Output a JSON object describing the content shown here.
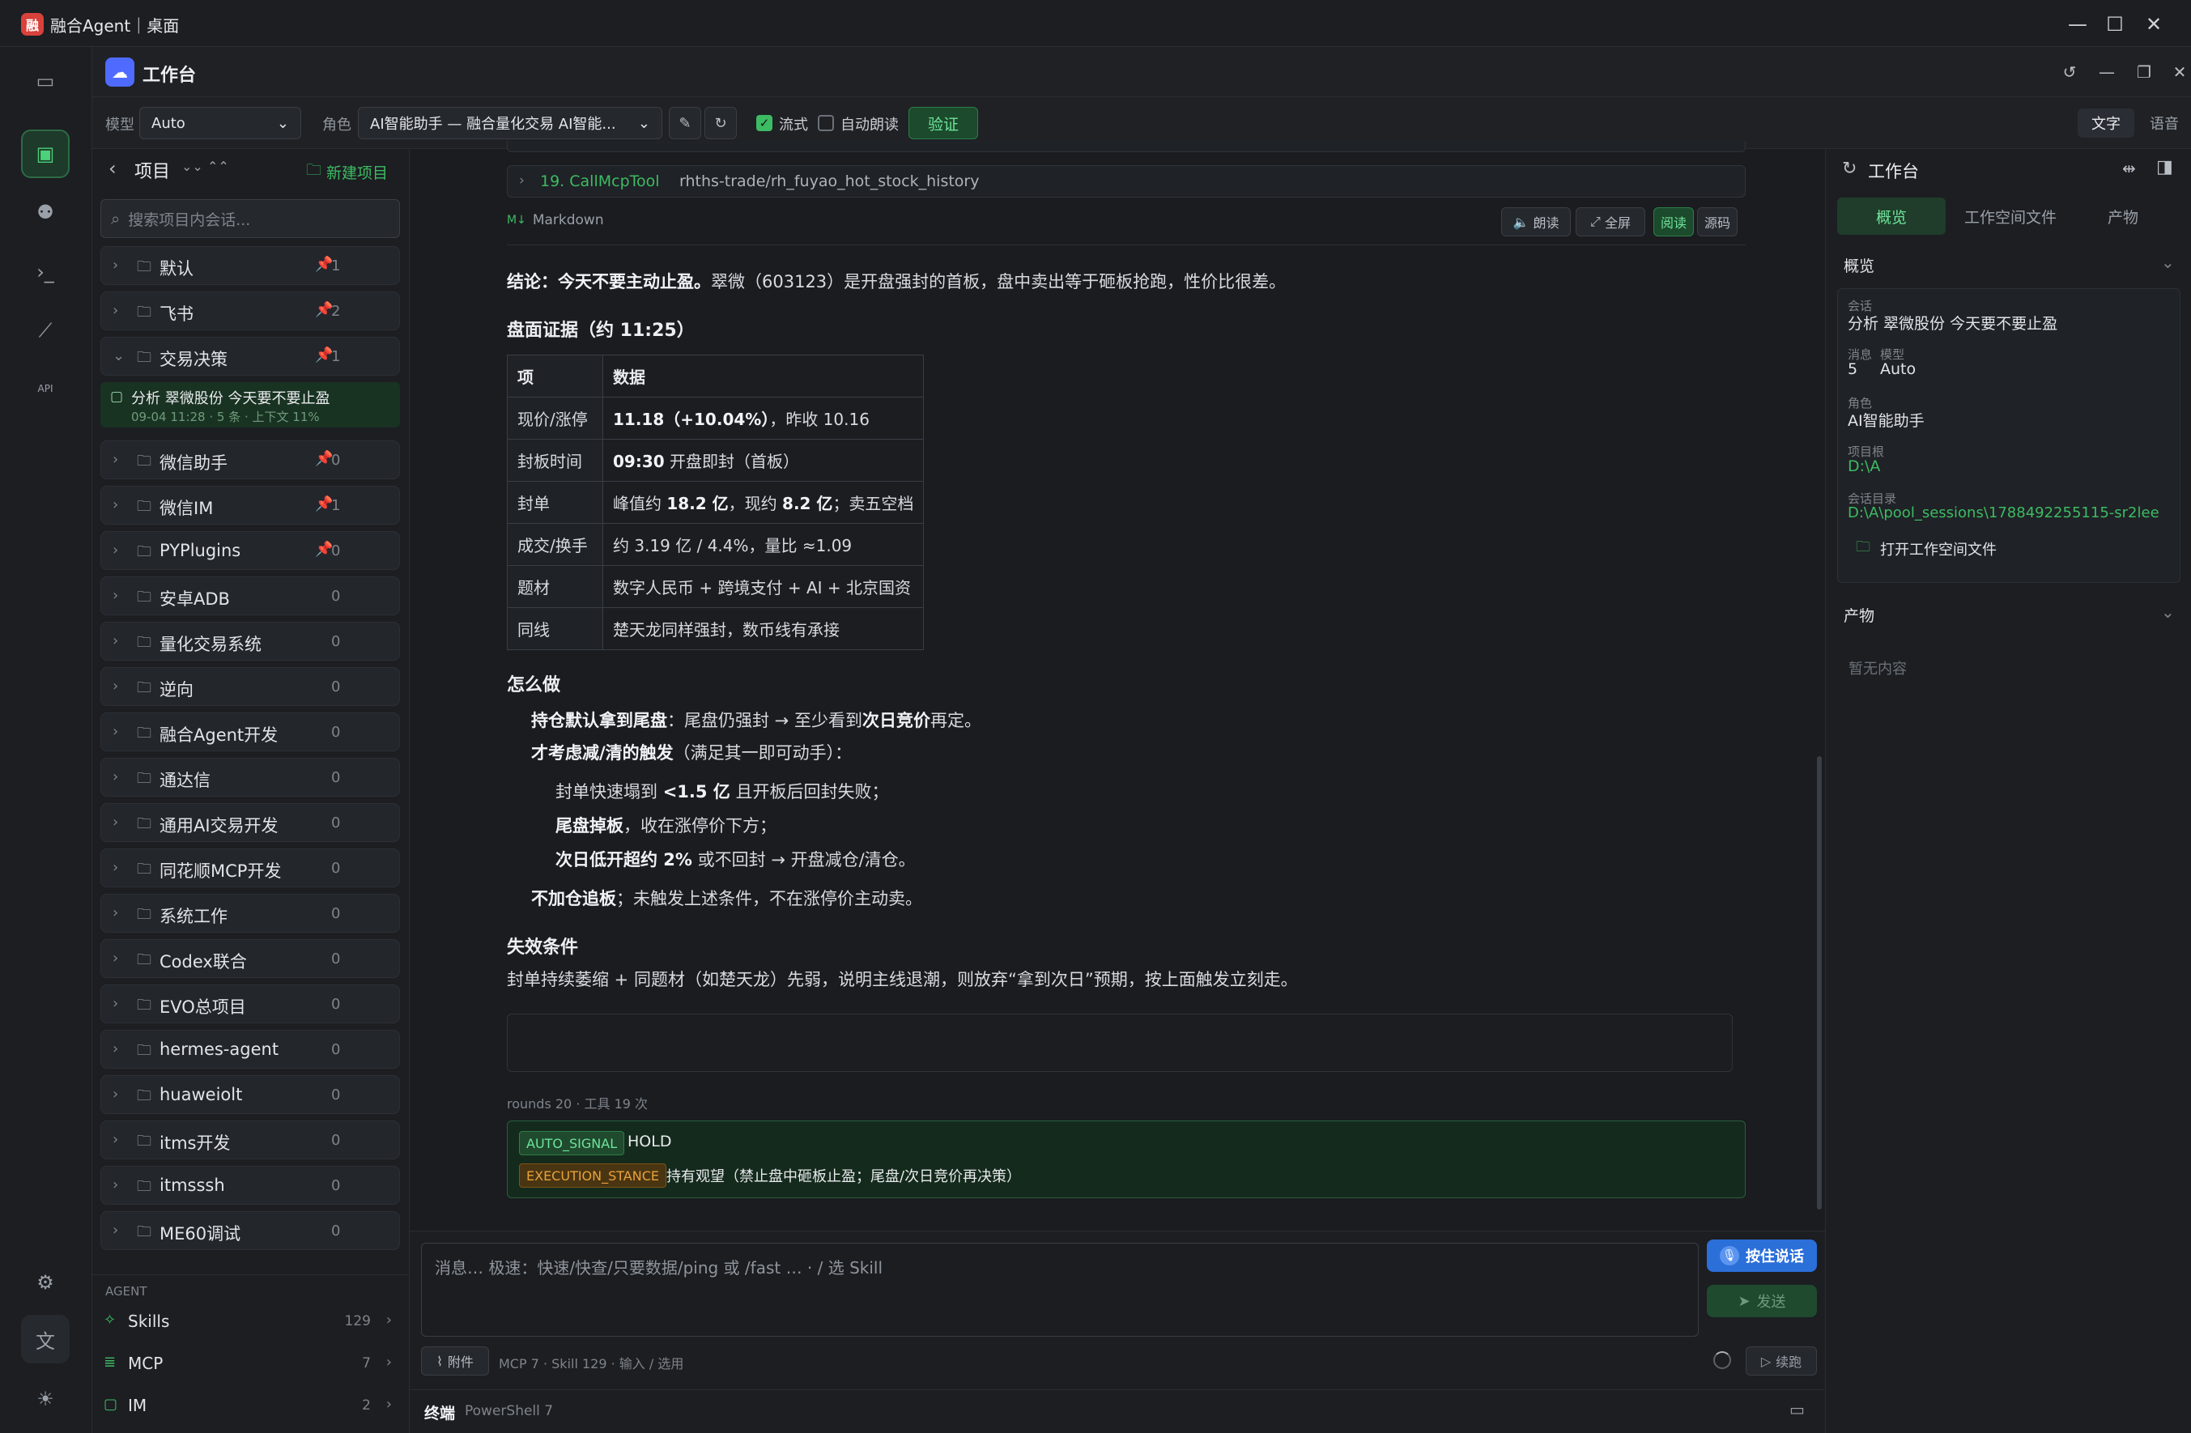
{
  "window": {
    "title": "融合Agent｜桌面",
    "logo": "融"
  },
  "app": {
    "title": "工作台",
    "icon": "☁"
  },
  "toolbar": {
    "model_label": "模型",
    "model_value": "Auto",
    "role_label": "角色",
    "role_value": "AI智能助手 — 融合量化交易 AI智能...",
    "stream_label": "流式",
    "stream_checked": true,
    "autoread_label": "自动朗读",
    "autoread_checked": false,
    "verify_label": "验证",
    "mode_text": "文字",
    "mode_voice": "语音"
  },
  "sidebar": {
    "back": "‹",
    "title": "项目",
    "new_project": "新建项目",
    "search_placeholder": "搜索项目内会话...",
    "projects": [
      {
        "name": "默认",
        "pin": true,
        "count": "1"
      },
      {
        "name": "飞书",
        "pin": true,
        "count": "2"
      },
      {
        "name": "交易决策",
        "pin": true,
        "count": "1",
        "expanded": true
      },
      {
        "name": "微信助手",
        "pin": true,
        "count": "0"
      },
      {
        "name": "微信IM",
        "pin": true,
        "count": "1"
      },
      {
        "name": "PYPlugins",
        "pin": true,
        "count": "0"
      },
      {
        "name": "安卓ADB",
        "pin": false,
        "count": "0"
      },
      {
        "name": "量化交易系统",
        "pin": false,
        "count": "0"
      },
      {
        "name": "逆向",
        "pin": false,
        "count": "0"
      },
      {
        "name": "融合Agent开发",
        "pin": false,
        "count": "0"
      },
      {
        "name": "通达信",
        "pin": false,
        "count": "0"
      },
      {
        "name": "通用AI交易开发",
        "pin": false,
        "count": "0"
      },
      {
        "name": "同花顺MCP开发",
        "pin": false,
        "count": "0"
      },
      {
        "name": "系统工作",
        "pin": false,
        "count": "0"
      },
      {
        "name": "Codex联合",
        "pin": false,
        "count": "0"
      },
      {
        "name": "EVO总项目",
        "pin": false,
        "count": "0"
      },
      {
        "name": "hermes-agent",
        "pin": false,
        "count": "0"
      },
      {
        "name": "huaweiolt",
        "pin": false,
        "count": "0"
      },
      {
        "name": "itms开发",
        "pin": false,
        "count": "0"
      },
      {
        "name": "itmsssh",
        "pin": false,
        "count": "0"
      },
      {
        "name": "ME60调试",
        "pin": false,
        "count": "0"
      }
    ],
    "session": {
      "title": "分析 翠微股份 今天要不要止盈",
      "meta": "09-04 11:28 · 5 条 · 上下文 11%"
    },
    "agent_header": "AGENT",
    "agent_items": [
      {
        "name": "Skills",
        "count": "129"
      },
      {
        "name": "MCP",
        "count": "7"
      },
      {
        "name": "IM",
        "count": "2"
      }
    ]
  },
  "chat": {
    "tool_call": {
      "title": "19. CallMcpTool",
      "args": "rhths-trade/rh_fuyao_hot_stock_history"
    },
    "format_label": "Markdown",
    "md_buttons": {
      "read_aloud": "朗读",
      "fullscreen": "全屏",
      "read": "阅读",
      "source": "源码"
    },
    "conclusion_bold": "结论：今天不要主动止盈。",
    "conclusion_rest": "翠微（603123）是开盘强封的首板，盘中卖出等于砸板抢跑，性价比很差。",
    "evidence_title": "盘面证据（约 11:25）",
    "table_headers": [
      "项",
      "数据"
    ],
    "table_rows": [
      {
        "k": "现价/涨停",
        "v1": "11.18（+10.04%）",
        "v2": "，昨收 10.16"
      },
      {
        "k": "封板时间",
        "v1": "09:30",
        "v2": " 开盘即封（首板）"
      },
      {
        "k": "封单",
        "v0": "峰值约 ",
        "v1": "18.2 亿",
        "v2": "，现约 ",
        "v3": "8.2 亿",
        "v4": "；卖五空档"
      },
      {
        "k": "成交/换手",
        "v2": "约 3.19 亿 / 4.4%，量比 ≈1.09"
      },
      {
        "k": "题材",
        "v2": "数字人民币 + 跨境支付 + AI + 北京国资"
      },
      {
        "k": "同线",
        "v2": "楚天龙同样强封，数币线有承接"
      }
    ],
    "howto_title": "怎么做",
    "howto_1_bold": "持仓默认拿到尾盘",
    "howto_1_rest": "：尾盘仍强封 → 至少看到",
    "howto_1_bold2": "次日竞价",
    "howto_1_end": "再定。",
    "howto_2_bold": "才考虑减/清的触发",
    "howto_2_rest": "（满足其一即可动手）：",
    "trigger_1_pre": "封单快速塌到 ",
    "trigger_1_bold": "<1.5 亿",
    "trigger_1_rest": " 且开板后回封失败；",
    "trigger_2_bold": "尾盘掉板",
    "trigger_2_rest": "，收在涨停价下方；",
    "trigger_3_bold": "次日低开超约 2%",
    "trigger_3_rest": " 或不回封 → 开盘减仓/清仓。",
    "howto_3_bold": "不加仓追板",
    "howto_3_rest": "；未触发上述条件，不在涨停价主动卖。",
    "fail_title": "失效条件",
    "fail_text": "封单持续萎缩 + 同题材（如楚天龙）先弱，说明主线退潮，则放弃“拿到次日”预期，按上面触发立刻走。",
    "rounds": "rounds 20 · 工具 19 次",
    "signal_tag": "AUTO_SIGNAL",
    "signal_value": "HOLD",
    "stance_tag": "EXECUTION_STANCE",
    "stance_value": "持有观望（禁止盘中砸板止盈；尾盘/次日竞价再决策）"
  },
  "input": {
    "placeholder": "消息…  极速：快速/快查/只要数据/ping 或 /fast …  ·  / 选 Skill",
    "ptt": "按住说话",
    "send": "发送",
    "attach": "附件",
    "status": "MCP 7 · Skill 129 · 输入 / 选用",
    "continue": "续跑"
  },
  "terminal": {
    "label": "终端",
    "shell": "PowerShell 7"
  },
  "right": {
    "title": "工作台",
    "tabs": [
      "概览",
      "工作空间文件",
      "产物"
    ],
    "overview_title": "概览",
    "session_label": "会话",
    "session_value": "分析 翠微股份 今天要不要止盈",
    "msg_label": "消息",
    "msg_value": "5",
    "model_label": "模型",
    "model_value": "Auto",
    "role_label": "角色",
    "role_value": "AI智能助手",
    "root_label": "项目根",
    "root_value": "D:\\A",
    "dir_label": "会话目录",
    "dir_value": "D:\\A\\pool_sessions\\1788492255115-sr2lee",
    "open_ws": "打开工作空间文件",
    "artifacts_title": "产物",
    "empty": "暂无内容"
  },
  "colors": {
    "accent_green": "#3dbb63",
    "pin": "#e0a82e",
    "ptt_blue": "#2b6fd9",
    "tag_green": "#6fe39a",
    "tag_orange": "#e8a23a"
  }
}
